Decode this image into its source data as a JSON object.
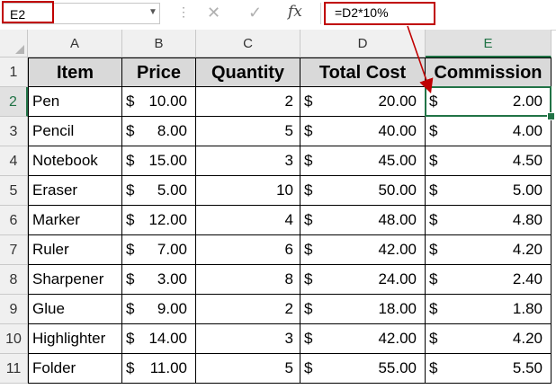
{
  "name_box": {
    "value": "E2"
  },
  "formula_bar": {
    "cancel_icon": "x-icon",
    "enter_icon": "check-icon",
    "function_label": "fx",
    "formula": "=D2*10%"
  },
  "colors": {
    "accent": "#217346",
    "highlight": "#c00000",
    "header_fill": "#d9d9d9"
  },
  "active_cell": "E2",
  "columns": [
    "A",
    "B",
    "C",
    "D",
    "E"
  ],
  "rows": [
    "1",
    "2",
    "3",
    "4",
    "5",
    "6",
    "7",
    "8",
    "9",
    "10",
    "11"
  ],
  "table": {
    "headers": [
      "Item",
      "Price",
      "Quantity",
      "Total Cost",
      "Commission"
    ],
    "rows": [
      {
        "item": "Pen",
        "price": "10.00",
        "qty": "2",
        "total": "20.00",
        "comm": "2.00"
      },
      {
        "item": "Pencil",
        "price": "8.00",
        "qty": "5",
        "total": "40.00",
        "comm": "4.00"
      },
      {
        "item": "Notebook",
        "price": "15.00",
        "qty": "3",
        "total": "45.00",
        "comm": "4.50"
      },
      {
        "item": "Eraser",
        "price": "5.00",
        "qty": "10",
        "total": "50.00",
        "comm": "5.00"
      },
      {
        "item": "Marker",
        "price": "12.00",
        "qty": "4",
        "total": "48.00",
        "comm": "4.80"
      },
      {
        "item": "Ruler",
        "price": "7.00",
        "qty": "6",
        "total": "42.00",
        "comm": "4.20"
      },
      {
        "item": "Sharpener",
        "price": "3.00",
        "qty": "8",
        "total": "24.00",
        "comm": "2.40"
      },
      {
        "item": "Glue",
        "price": "9.00",
        "qty": "2",
        "total": "18.00",
        "comm": "1.80"
      },
      {
        "item": "Highlighter",
        "price": "14.00",
        "qty": "3",
        "total": "42.00",
        "comm": "4.20"
      },
      {
        "item": "Folder",
        "price": "11.00",
        "qty": "5",
        "total": "55.00",
        "comm": "5.50"
      }
    ]
  },
  "currency_symbol": "$"
}
